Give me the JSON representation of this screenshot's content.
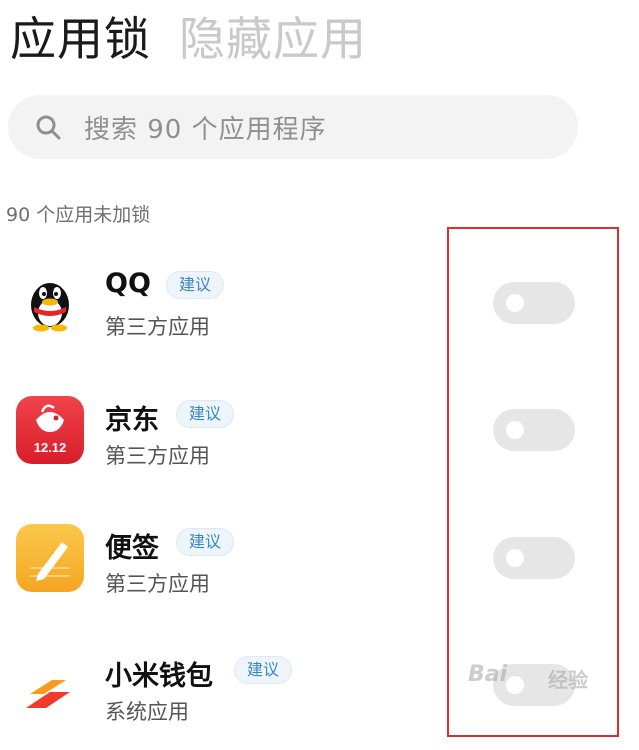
{
  "tabs": {
    "active": "应用锁",
    "inactive": "隐藏应用"
  },
  "search": {
    "placeholder": "搜索 90 个应用程序",
    "icon": "search-icon"
  },
  "section": {
    "count_label": "90 个应用未加锁"
  },
  "apps": [
    {
      "name": "QQ",
      "badge": "建议",
      "category": "第三方应用",
      "icon": "qq-penguin-icon",
      "locked": false
    },
    {
      "name": "京东",
      "badge": "建议",
      "category": "第三方应用",
      "icon": "jd-icon",
      "icon_text": "12.12",
      "locked": false
    },
    {
      "name": "便签",
      "badge": "建议",
      "category": "第三方应用",
      "icon": "notes-icon",
      "locked": false
    },
    {
      "name": "小米钱包",
      "badge": "建议",
      "category": "系统应用",
      "icon": "mi-wallet-icon",
      "locked": false
    }
  ],
  "watermark": {
    "text": "Bai",
    "suffix": "经验"
  },
  "colors": {
    "badge_text": "#3a86c8",
    "highlight_box": "#d9302a",
    "toggle_off": "#e6e6e6"
  }
}
